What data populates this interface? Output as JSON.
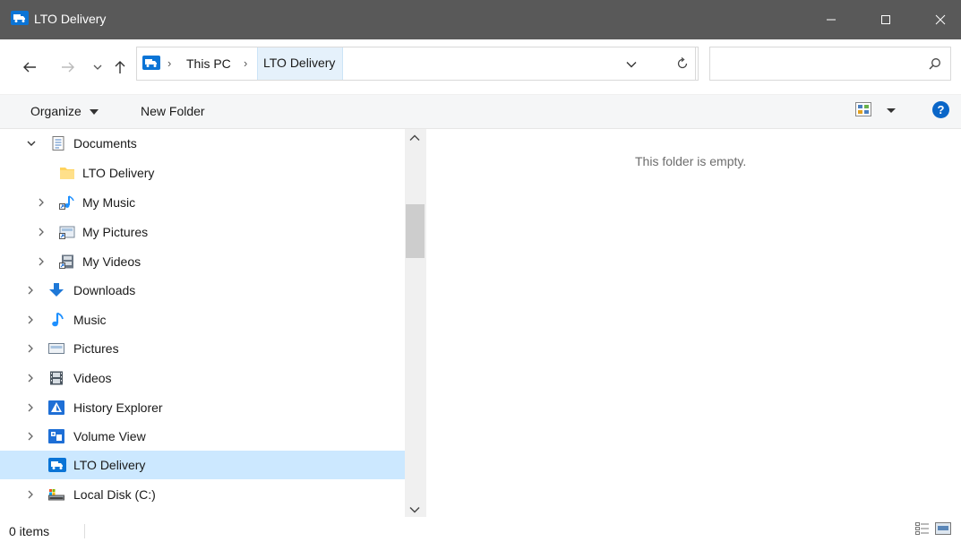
{
  "window": {
    "title": "LTO Delivery",
    "minimize_label": "—",
    "maximize_label": "☐",
    "close_label": "✕"
  },
  "navigation": {
    "back_icon": "back-arrow-icon",
    "forward_icon": "forward-arrow-icon",
    "recent_icon": "chevron-down-icon",
    "up_icon": "up-arrow-icon"
  },
  "address": {
    "separator": "›",
    "crumbs": [
      "This PC",
      "LTO Delivery"
    ],
    "search_placeholder": ""
  },
  "toolbar": {
    "organize_label": "Organize",
    "new_folder_label": "New Folder",
    "help_label": "?"
  },
  "tree": {
    "items": [
      {
        "label": "Documents",
        "icon": "documents-icon",
        "expanded": true
      },
      {
        "label": "LTO Delivery",
        "icon": "folder-icon"
      },
      {
        "label": "My Music",
        "icon": "music-shortcut-icon"
      },
      {
        "label": "My Pictures",
        "icon": "pictures-shortcut-icon"
      },
      {
        "label": "My Videos",
        "icon": "videos-shortcut-icon"
      },
      {
        "label": "Downloads",
        "icon": "download-arrow-icon"
      },
      {
        "label": "Music",
        "icon": "music-note-icon"
      },
      {
        "label": "Pictures",
        "icon": "pictures-icon"
      },
      {
        "label": "Videos",
        "icon": "film-icon"
      },
      {
        "label": "History Explorer",
        "icon": "history-explorer-icon"
      },
      {
        "label": "Volume View",
        "icon": "volume-view-icon"
      },
      {
        "label": "LTO Delivery",
        "icon": "truck-icon",
        "selected": true
      },
      {
        "label": "Local Disk (C:)",
        "icon": "drive-icon"
      }
    ]
  },
  "content": {
    "empty_message": "This folder is empty."
  },
  "status": {
    "item_count": "0 items"
  },
  "colors": {
    "titlebar": "#595959",
    "selection": "#cce8ff",
    "accent": "#0078d7"
  }
}
